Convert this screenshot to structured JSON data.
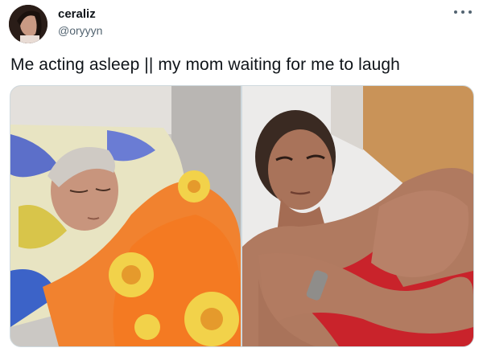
{
  "author": {
    "display_name": "ceraliz",
    "handle": "@oryyyn"
  },
  "tweet": {
    "text": "Me acting asleep || my mom waiting for me to laugh"
  },
  "icons": {
    "more": "more-horizontal-icon"
  },
  "media": {
    "count": 2
  }
}
